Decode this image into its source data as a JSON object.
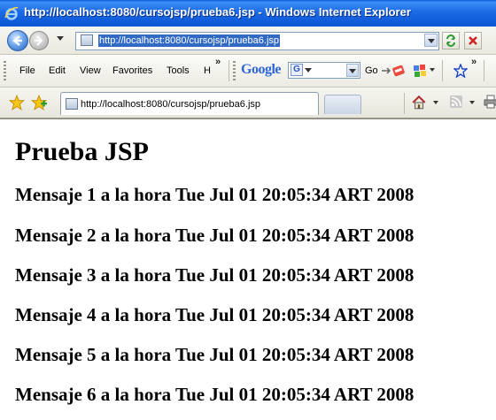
{
  "window": {
    "title": "http://localhost:8080/cursojsp/prueba6.jsp - Windows Internet Explorer"
  },
  "address_bar": {
    "url": "http://localhost:8080/cursojsp/prueba6.jsp"
  },
  "menu": {
    "items": [
      "File",
      "Edit",
      "View",
      "Favorites",
      "Tools",
      "H"
    ],
    "overflow": "»"
  },
  "google_toolbar": {
    "logo": "Google",
    "search_badge": "G",
    "go_label": "Go"
  },
  "toolbar_overflow": "»",
  "tab": {
    "label": "http://localhost:8080/cursojsp/prueba6.jsp"
  },
  "page": {
    "heading": "Prueba JSP",
    "messages": [
      "Mensaje 1 a la hora Tue Jul 01 20:05:34 ART 2008",
      "Mensaje 2 a la hora Tue Jul 01 20:05:34 ART 2008",
      "Mensaje 3 a la hora Tue Jul 01 20:05:34 ART 2008",
      "Mensaje 4 a la hora Tue Jul 01 20:05:34 ART 2008",
      "Mensaje 5 a la hora Tue Jul 01 20:05:34 ART 2008",
      "Mensaje 6 a la hora Tue Jul 01 20:05:34 ART 2008"
    ]
  },
  "colors": {
    "titlebar": "#0b55d4",
    "url_highlight": "#316ac5"
  }
}
